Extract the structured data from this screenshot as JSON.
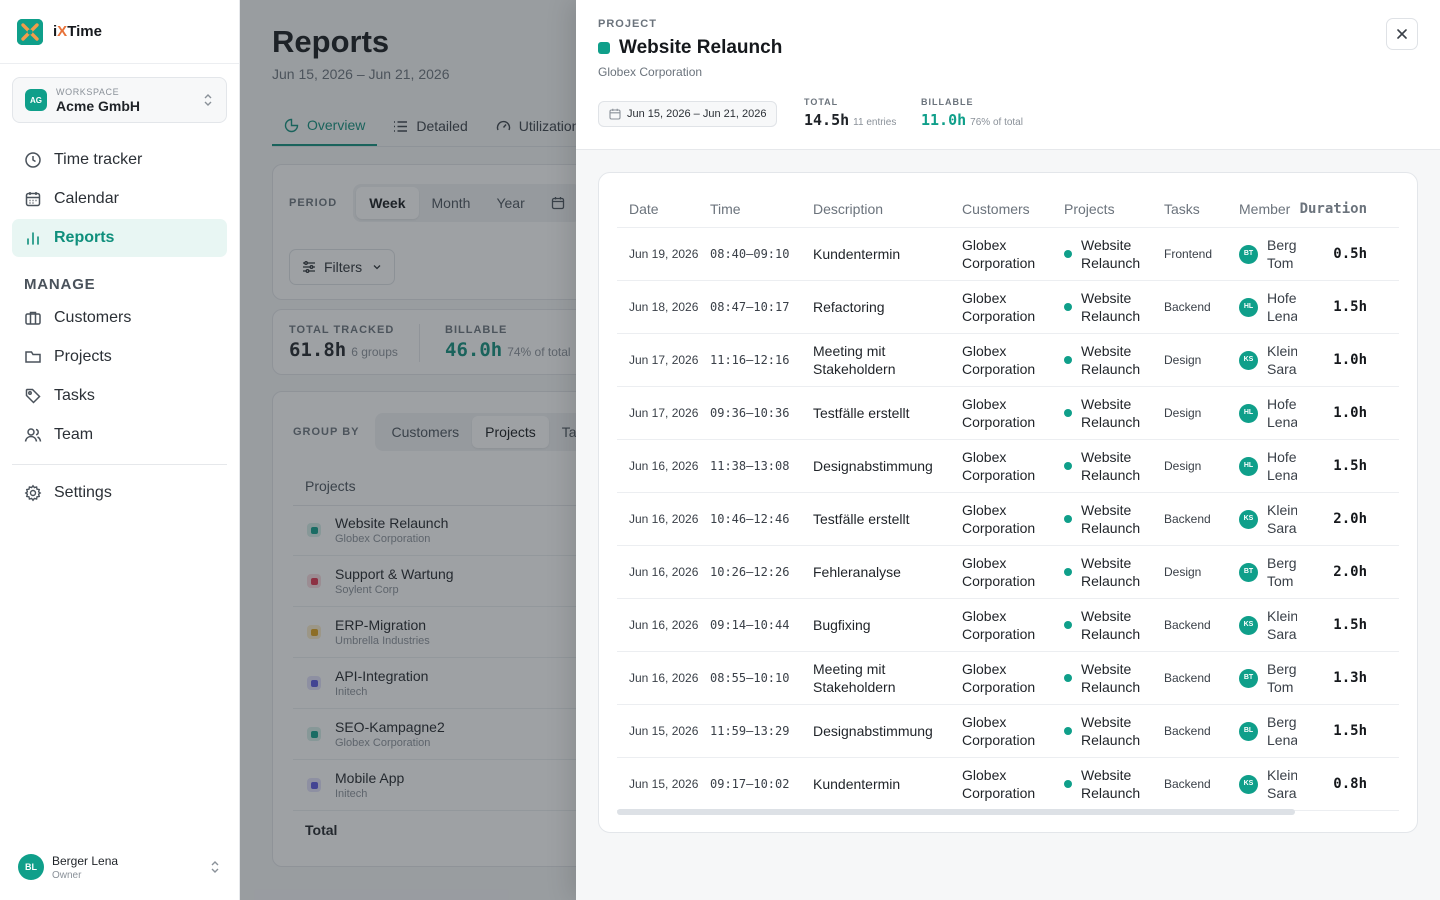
{
  "app": {
    "brand_prefix": "i",
    "brand_x": "X",
    "brand_suffix": "Time",
    "logo_icon": "ixtime-logo"
  },
  "workspace": {
    "label": "WORKSPACE",
    "name": "Acme GmbH",
    "initials": "AG"
  },
  "nav": {
    "items": [
      {
        "label": "Time tracker",
        "icon": "clock-icon"
      },
      {
        "label": "Calendar",
        "icon": "calendar-icon"
      },
      {
        "label": "Reports",
        "icon": "bar-chart-icon"
      }
    ],
    "section_manage": "MANAGE",
    "manage_items": [
      {
        "label": "Customers",
        "icon": "briefcase-icon"
      },
      {
        "label": "Projects",
        "icon": "folder-icon"
      },
      {
        "label": "Tasks",
        "icon": "tag-icon"
      },
      {
        "label": "Team",
        "icon": "users-icon"
      }
    ],
    "settings": "Settings"
  },
  "user": {
    "initials": "BL",
    "name": "Berger Lena",
    "role": "Owner"
  },
  "page": {
    "title": "Reports",
    "range": "Jun 15, 2026 – Jun 21, 2026",
    "tabs": [
      "Overview",
      "Detailed",
      "Utilization"
    ],
    "period_label": "PERIOD",
    "period_options": [
      "Week",
      "Month",
      "Year"
    ],
    "filters_label": "Filters",
    "total_tracked_label": "TOTAL TRACKED",
    "total_tracked_value": "61.8h",
    "total_tracked_sub": "6 groups",
    "billable_label": "BILLABLE",
    "billable_value": "46.0h",
    "billable_sub": "74% of total",
    "group_by_label": "GROUP BY",
    "group_by_options": [
      "Customers",
      "Projects",
      "Ta"
    ],
    "projects_header": "Projects",
    "projects": [
      {
        "name": "Website Relaunch",
        "customer": "Globex Corporation",
        "color": "#0f9f8a",
        "bg": "#d6efe9"
      },
      {
        "name": "Support & Wartung",
        "customer": "Soylent Corp",
        "color": "#e0344f",
        "bg": "#fadbe0"
      },
      {
        "name": "ERP-Migration",
        "customer": "Umbrella Industries",
        "color": "#e0a21a",
        "bg": "#fbedcc"
      },
      {
        "name": "API-Integration",
        "customer": "Initech",
        "color": "#5a57e0",
        "bg": "#e2e1fb"
      },
      {
        "name": "SEO-Kampagne2",
        "customer": "Globex Corporation",
        "color": "#0f9f8a",
        "bg": "#d6efe9"
      },
      {
        "name": "Mobile App",
        "customer": "Initech",
        "color": "#5a57e0",
        "bg": "#e2e1fb"
      }
    ],
    "total_label": "Total"
  },
  "drawer": {
    "caps": "PROJECT",
    "title": "Website Relaunch",
    "customer": "Globex Corporation",
    "color": "#0f9f8a",
    "range": "Jun 15, 2026 – Jun 21, 2026",
    "total_label": "TOTAL",
    "total_value": "14.5h",
    "total_sub": "11 entries",
    "billable_label": "BILLABLE",
    "billable_value": "11.0h",
    "billable_sub": "76% of total",
    "columns": [
      "Date",
      "Time",
      "Description",
      "Customers",
      "Projects",
      "Tasks",
      "Member",
      "Duration"
    ],
    "entries": [
      {
        "date": "Jun 19, 2026",
        "time": "08:40–09:10",
        "desc": "Kundentermin",
        "customer": "Globex Corporation",
        "project": "Website Relaunch",
        "task": "Frontend",
        "initials": "BT",
        "member": "Berg Tom",
        "duration": "0.5h"
      },
      {
        "date": "Jun 18, 2026",
        "time": "08:47–10:17",
        "desc": "Refactoring",
        "customer": "Globex Corporation",
        "project": "Website Relaunch",
        "task": "Backend",
        "initials": "HL",
        "member": "Hofe Lena",
        "duration": "1.5h"
      },
      {
        "date": "Jun 17, 2026",
        "time": "11:16–12:16",
        "desc": "Meeting mit Stakeholdern",
        "customer": "Globex Corporation",
        "project": "Website Relaunch",
        "task": "Design",
        "initials": "KS",
        "member": "Klein Sara",
        "duration": "1.0h"
      },
      {
        "date": "Jun 17, 2026",
        "time": "09:36–10:36",
        "desc": "Testfälle erstellt",
        "customer": "Globex Corporation",
        "project": "Website Relaunch",
        "task": "Design",
        "initials": "HL",
        "member": "Hofe Lena",
        "duration": "1.0h"
      },
      {
        "date": "Jun 16, 2026",
        "time": "11:38–13:08",
        "desc": "Designabstimmung",
        "customer": "Globex Corporation",
        "project": "Website Relaunch",
        "task": "Design",
        "initials": "HL",
        "member": "Hofe Lena",
        "duration": "1.5h"
      },
      {
        "date": "Jun 16, 2026",
        "time": "10:46–12:46",
        "desc": "Testfälle erstellt",
        "customer": "Globex Corporation",
        "project": "Website Relaunch",
        "task": "Backend",
        "initials": "KS",
        "member": "Klein Sara",
        "duration": "2.0h"
      },
      {
        "date": "Jun 16, 2026",
        "time": "10:26–12:26",
        "desc": "Fehleranalyse",
        "customer": "Globex Corporation",
        "project": "Website Relaunch",
        "task": "Design",
        "initials": "BT",
        "member": "Berg Tom",
        "duration": "2.0h"
      },
      {
        "date": "Jun 16, 2026",
        "time": "09:14–10:44",
        "desc": "Bugfixing",
        "customer": "Globex Corporation",
        "project": "Website Relaunch",
        "task": "Backend",
        "initials": "KS",
        "member": "Klein Sara",
        "duration": "1.5h"
      },
      {
        "date": "Jun 16, 2026",
        "time": "08:55–10:10",
        "desc": "Meeting mit Stakeholdern",
        "customer": "Globex Corporation",
        "project": "Website Relaunch",
        "task": "Backend",
        "initials": "BT",
        "member": "Berg Tom",
        "duration": "1.3h"
      },
      {
        "date": "Jun 15, 2026",
        "time": "11:59–13:29",
        "desc": "Designabstimmung",
        "customer": "Globex Corporation",
        "project": "Website Relaunch",
        "task": "Backend",
        "initials": "BL",
        "member": "Berg Lena",
        "duration": "1.5h"
      },
      {
        "date": "Jun 15, 2026",
        "time": "09:17–10:02",
        "desc": "Kundentermin",
        "customer": "Globex Corporation",
        "project": "Website Relaunch",
        "task": "Backend",
        "initials": "KS",
        "member": "Klein Sara",
        "duration": "0.8h"
      }
    ]
  }
}
